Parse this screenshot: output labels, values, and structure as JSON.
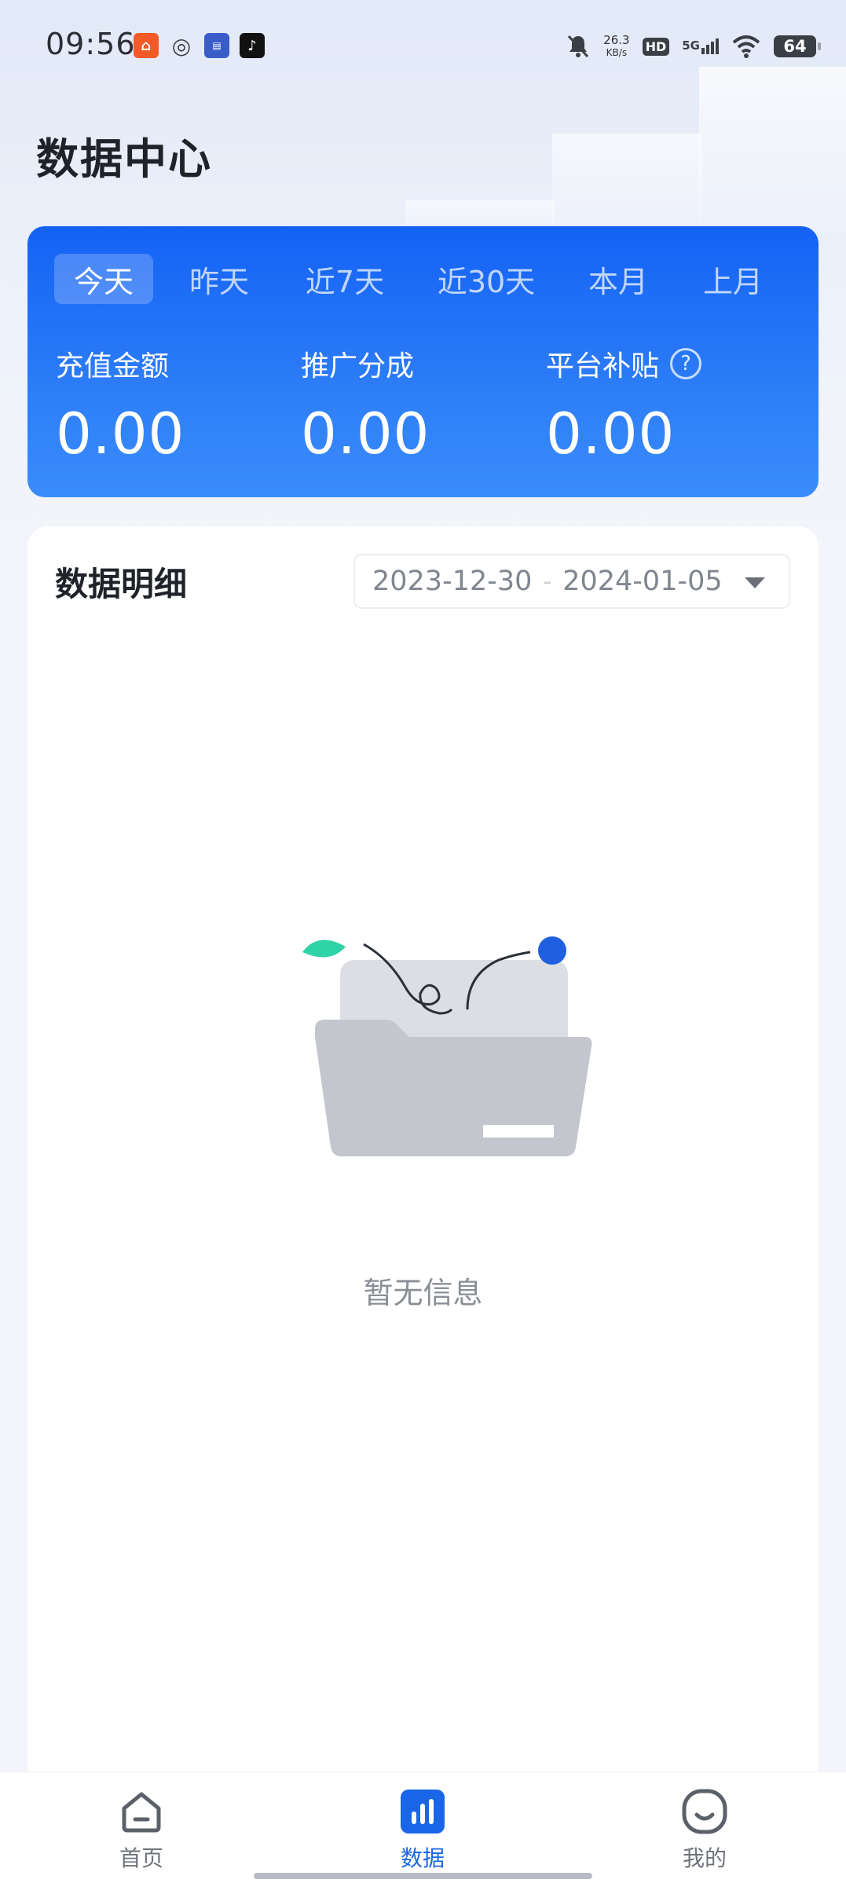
{
  "status_bar": {
    "time": "09:56",
    "net_speed_value": "26.3",
    "net_speed_unit": "KB/s",
    "hd_label": "HD",
    "network_label": "5G",
    "battery_level": "64",
    "app_icons": [
      "xiaohongshu-icon",
      "browser-icon",
      "news-app-icon",
      "tiktok-icon"
    ]
  },
  "page": {
    "title": "数据中心"
  },
  "summary": {
    "tabs": [
      {
        "label": "今天",
        "active": true
      },
      {
        "label": "昨天",
        "active": false
      },
      {
        "label": "近7天",
        "active": false
      },
      {
        "label": "近30天",
        "active": false
      },
      {
        "label": "本月",
        "active": false
      },
      {
        "label": "上月",
        "active": false
      }
    ],
    "metrics": [
      {
        "label": "充值金额",
        "value": "0.00"
      },
      {
        "label": "推广分成",
        "value": "0.00"
      },
      {
        "label": "平台补贴",
        "value": "0.00",
        "help": true
      }
    ],
    "help_glyph": "?",
    "colors": {
      "card_top": "#1462f5",
      "card_bottom": "#3b8cfb"
    }
  },
  "detail": {
    "title": "数据明细",
    "date_start": "2023-12-30",
    "date_separator": "-",
    "date_end": "2024-01-05",
    "empty_text": "暂无信息"
  },
  "bottom_nav": {
    "items": [
      {
        "label": "首页",
        "icon": "home-icon",
        "active": false
      },
      {
        "label": "数据",
        "icon": "data-chart-icon",
        "active": true
      },
      {
        "label": "我的",
        "icon": "profile-icon",
        "active": false
      }
    ],
    "active_color": "#1967e8"
  }
}
